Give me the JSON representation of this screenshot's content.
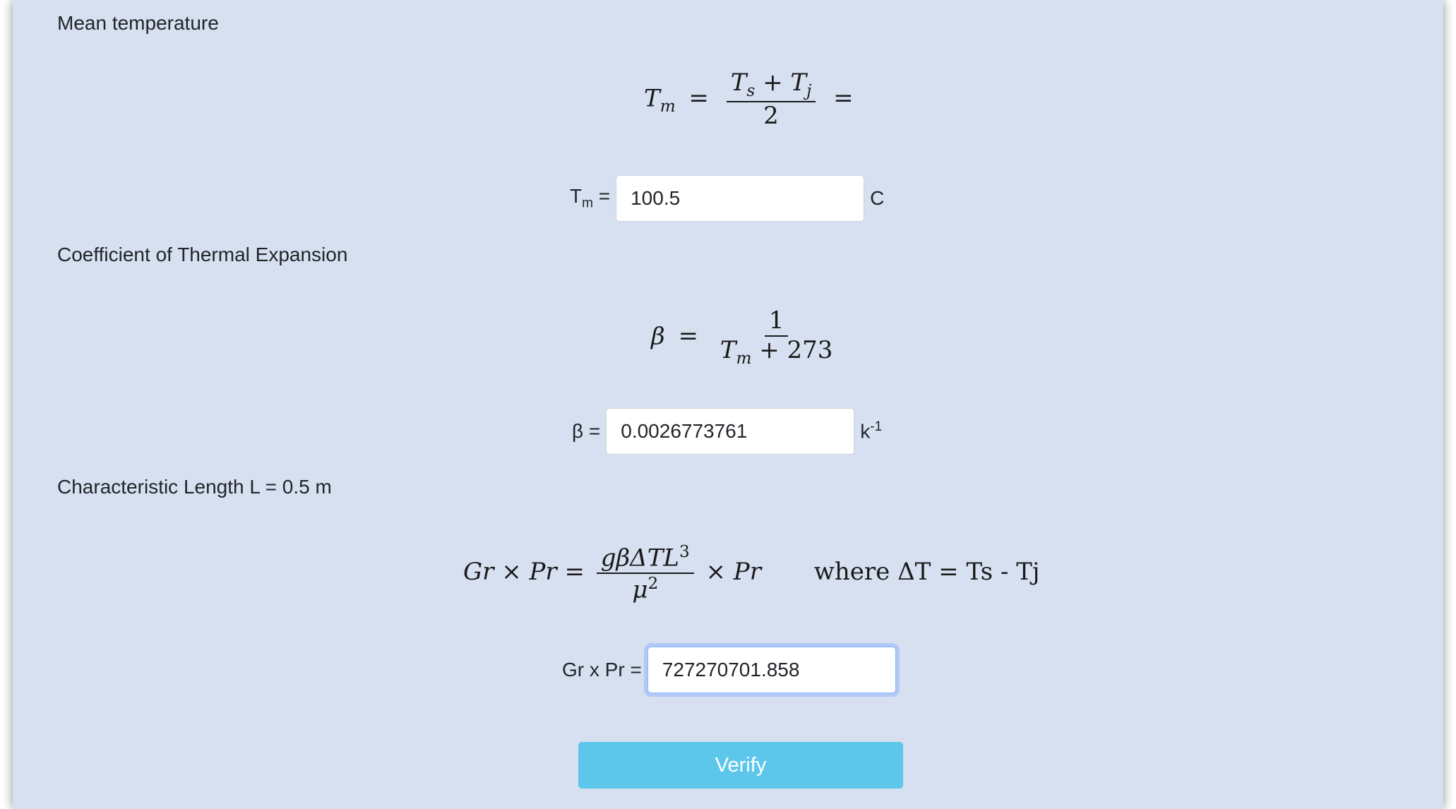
{
  "sections": {
    "mean_temp": {
      "heading": "Mean temperature",
      "label_main": "T",
      "label_sub": "m",
      "label_eq": " =",
      "value": "100.5",
      "unit": "C"
    },
    "beta": {
      "heading": "Coefficient of Thermal Expansion",
      "label": "β =",
      "value": "0.0026773761",
      "unit_main": "k",
      "unit_sup": "-1"
    },
    "grpr": {
      "heading": "Characteristic Length L = 0.5 m",
      "label": "Gr x Pr =",
      "value": "727270701.858"
    }
  },
  "formulas": {
    "tm": {
      "lhs": "T",
      "lhs_sub": "m",
      "eq": "=",
      "num": "T",
      "num_sub1": "s",
      "plus": " + ",
      "num2": "T",
      "num_sub2": "j",
      "den": "2",
      "tail": "="
    },
    "beta": {
      "lhs": "β",
      "eq": "=",
      "num": "1",
      "den": "T",
      "den_sub": "m",
      "den_rest": " + 273"
    },
    "grpr": {
      "lhs": "Gr × Pr =",
      "num": "gβΔTL",
      "num_sup": "3",
      "den": "μ",
      "den_sup": "2",
      "mult": "× Pr",
      "where": "where ΔT = Ts - Tj"
    }
  },
  "verify_label": "Verify"
}
